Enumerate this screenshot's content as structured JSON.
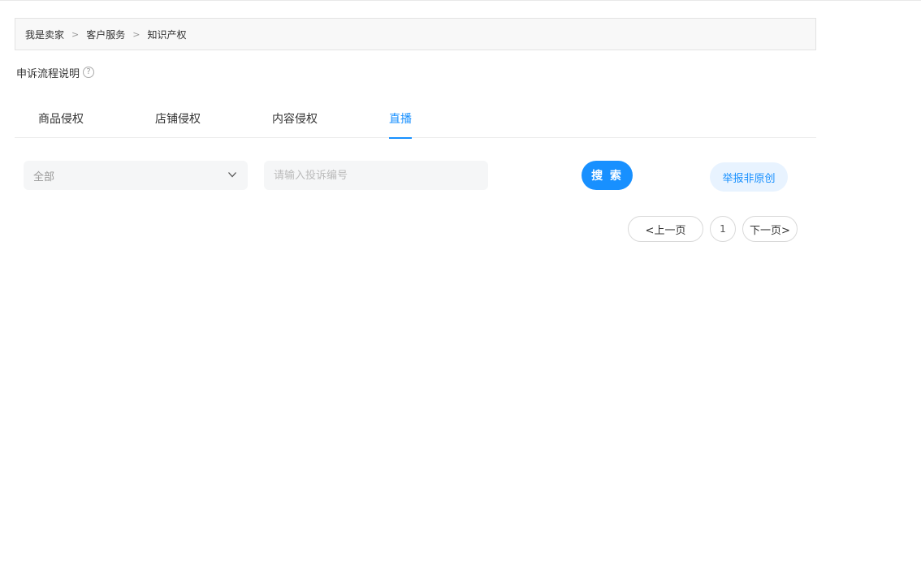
{
  "breadcrumb": {
    "items": [
      "我是卖家",
      "客户服务",
      "知识产权"
    ],
    "separator": ">"
  },
  "help": {
    "label": "申诉流程说明",
    "icon": "question-circle-icon",
    "icon_glyph": "?"
  },
  "tabs": [
    {
      "label": "商品侵权",
      "active": false
    },
    {
      "label": "店铺侵权",
      "active": false
    },
    {
      "label": "内容侵权",
      "active": false
    },
    {
      "label": "直播",
      "active": true
    }
  ],
  "filter": {
    "select_value": "全部",
    "search_placeholder": "请输入投诉编号",
    "search_value": ""
  },
  "actions": {
    "search_label": "搜 索",
    "report_label": "举报非原创"
  },
  "pagination": {
    "prev_label": "<上一页",
    "current_page": "1",
    "next_label": "下一页>"
  },
  "colors": {
    "accent": "#1890ff",
    "accent_light": "#e8f3ff",
    "input_bg": "#f5f6f7"
  }
}
